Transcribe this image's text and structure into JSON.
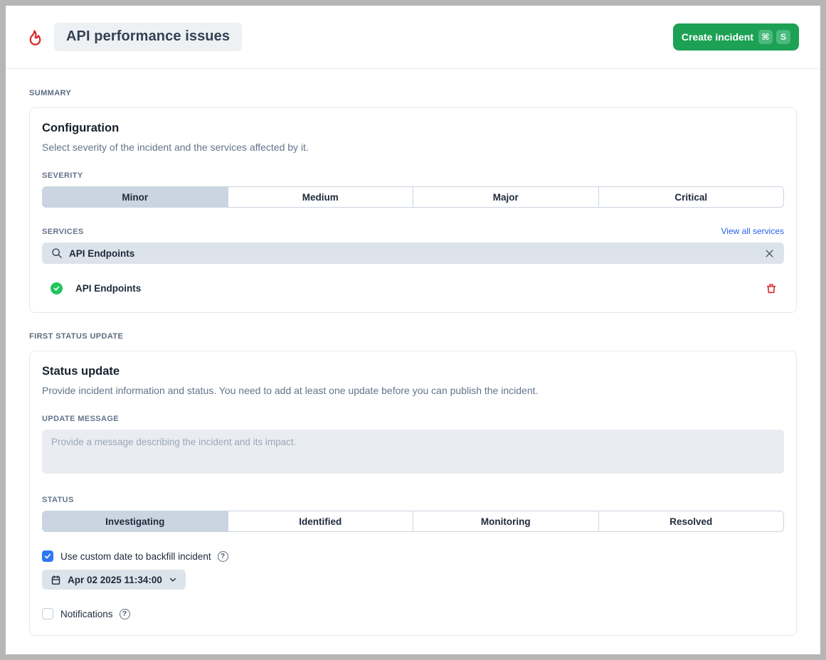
{
  "header": {
    "incident_title": "API performance issues",
    "create_button": {
      "label": "Create incident",
      "kbd": [
        "⌘",
        "S"
      ]
    }
  },
  "summary_section": {
    "label": "SUMMARY",
    "card": {
      "title": "Configuration",
      "subtitle": "Select severity of the incident and the services affected by it.",
      "severity": {
        "label": "SEVERITY",
        "options": [
          "Minor",
          "Medium",
          "Major",
          "Critical"
        ],
        "selected": "Minor"
      },
      "services": {
        "label": "SERVICES",
        "view_all_link": "View all services",
        "search_value": "API Endpoints",
        "selected": [
          {
            "name": "API Endpoints",
            "status": "operational"
          }
        ]
      }
    }
  },
  "status_section": {
    "label": "FIRST STATUS UPDATE",
    "card": {
      "title": "Status update",
      "subtitle": "Provide incident information and status. You need to add at least one update before you can publish the incident.",
      "update_message": {
        "label": "UPDATE MESSAGE",
        "placeholder": "Provide a message describing the incident and its impact.",
        "value": ""
      },
      "status": {
        "label": "STATUS",
        "options": [
          "Investigating",
          "Identified",
          "Monitoring",
          "Resolved"
        ],
        "selected": "Investigating"
      },
      "backfill": {
        "label": "Use custom date to backfill incident",
        "checked": true,
        "date_value": "Apr 02 2025 11:34:00"
      },
      "notifications": {
        "label": "Notifications",
        "checked": false
      }
    }
  },
  "colors": {
    "accent_green": "#1ca155",
    "accent_blue": "#2563eb",
    "danger_red": "#dc2626",
    "segment_selected_bg": "#cbd5e1",
    "operational_green": "#22c55e"
  }
}
